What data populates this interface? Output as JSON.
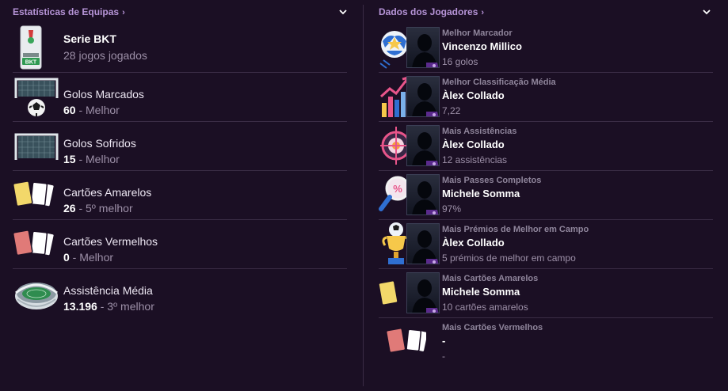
{
  "left": {
    "title": "Estatísticas de Equipas",
    "rows": [
      {
        "label": "Serie BKT",
        "value": "28 jogos jogados"
      },
      {
        "label": "Golos Marcados",
        "value_main": "60",
        "value_rest": " - Melhor"
      },
      {
        "label": "Golos Sofridos",
        "value_main": "15",
        "value_rest": " - Melhor"
      },
      {
        "label": "Cartões Amarelos",
        "value_main": "26",
        "value_rest": " - 5º melhor"
      },
      {
        "label": "Cartões Vermelhos",
        "value_main": "0",
        "value_rest": " - Melhor"
      },
      {
        "label": "Assistência Média",
        "value_main": "13.196",
        "value_rest": " - 3º melhor"
      }
    ]
  },
  "right": {
    "title": "Dados dos Jogadores",
    "rows": [
      {
        "category": "Melhor Marcador",
        "name": "Vincenzo Millico",
        "value": "16 golos"
      },
      {
        "category": "Melhor Classificação Média",
        "name": "Àlex Collado",
        "value": "7,22"
      },
      {
        "category": "Mais Assistências",
        "name": "Àlex Collado",
        "value": "12 assistências"
      },
      {
        "category": "Mais Passes Completos",
        "name": "Michele Somma",
        "value": "97%"
      },
      {
        "category": "Mais Prémios de Melhor em Campo",
        "name": "Àlex Collado",
        "value": "5 prémios de melhor em campo"
      },
      {
        "category": "Mais Cartões Amarelos",
        "name": "Michele Somma",
        "value": "10 cartões amarelos"
      },
      {
        "category": "Mais Cartões Vermelhos",
        "name": "-",
        "value": "-"
      }
    ]
  },
  "icons": {
    "chevron_right": "›",
    "chevron_down": "chevron-down-icon"
  },
  "colors": {
    "background": "#1b0f24",
    "accent": "#b795d8",
    "divider": "#3a2c45",
    "muted": "#9d90a8"
  }
}
